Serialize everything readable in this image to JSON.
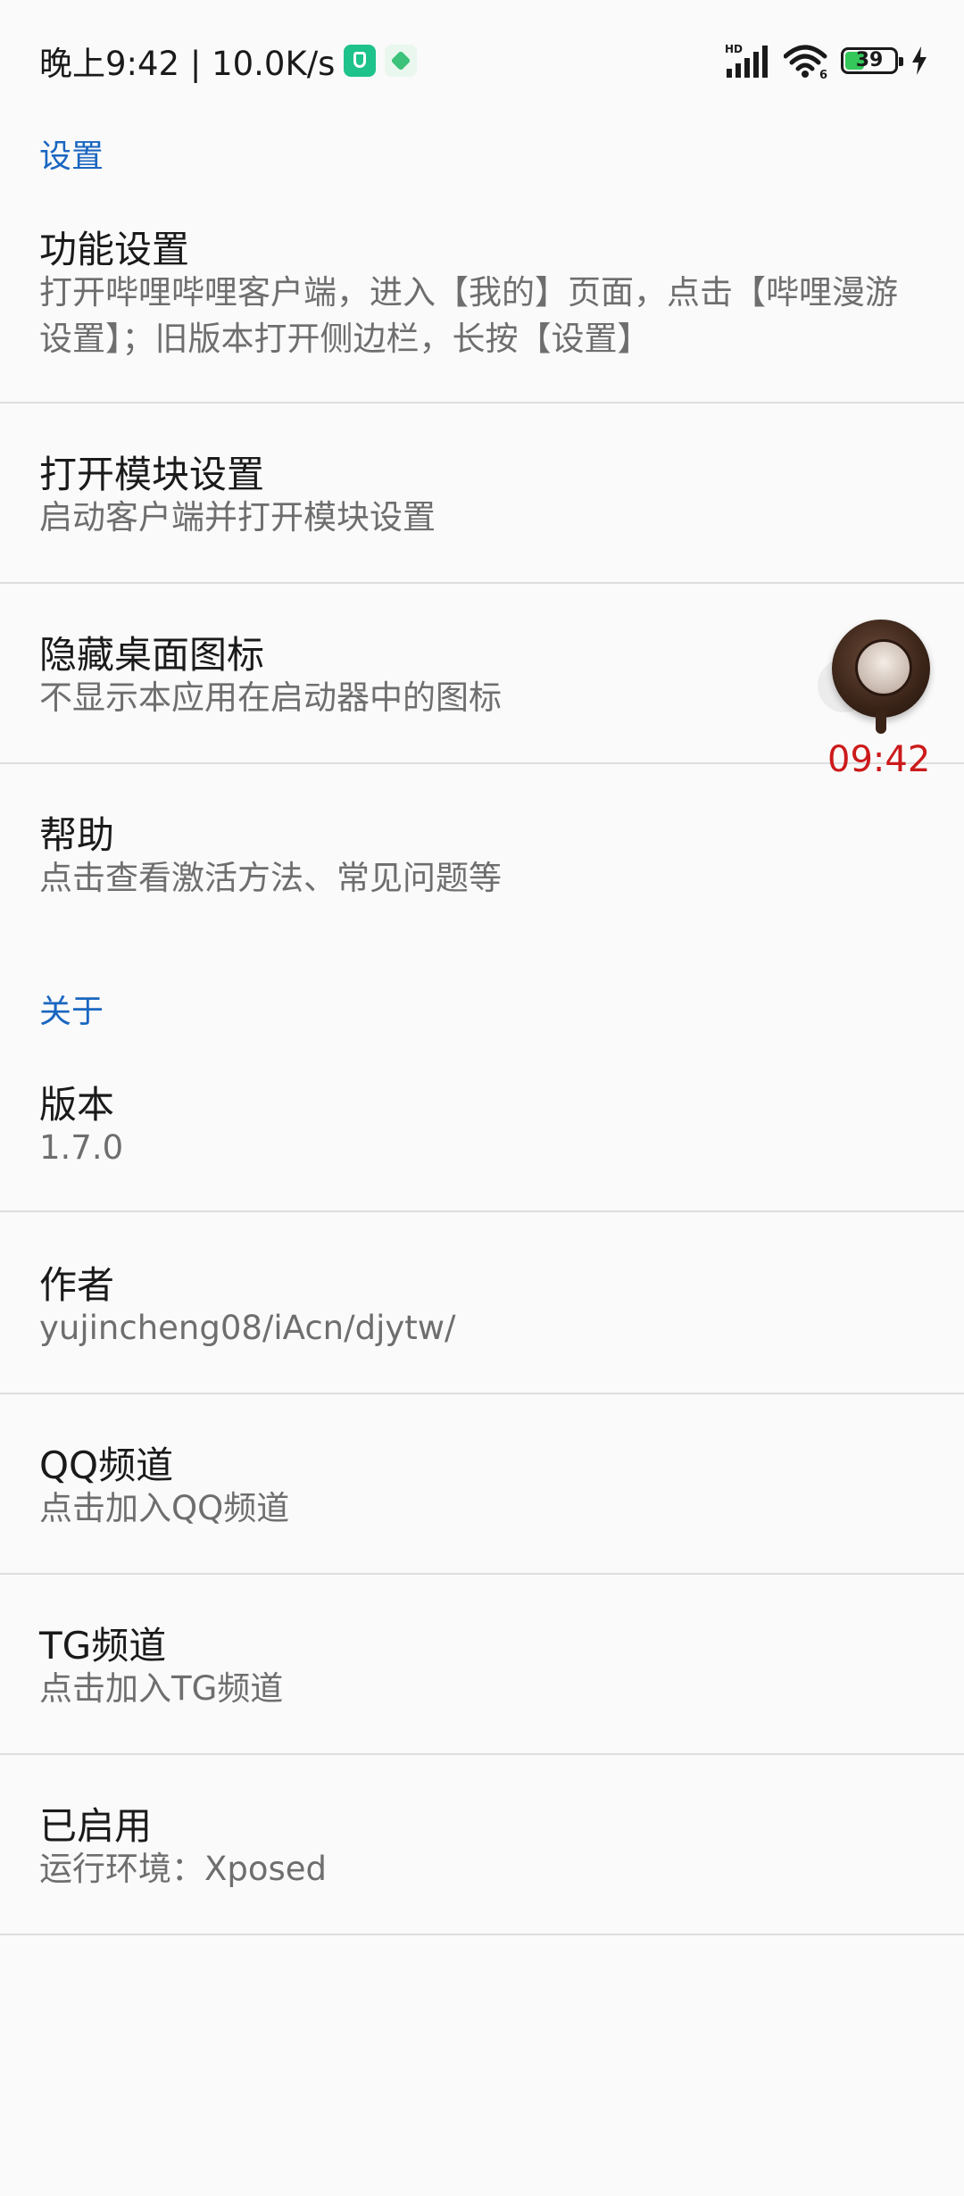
{
  "status_bar": {
    "time_speed": "晚上9:42 | 10.0K/s",
    "signal_label": "HD",
    "wifi_label": "6",
    "battery_level": "39",
    "battery_fraction": 0.39,
    "app_icons": [
      "shield-app-icon",
      "cube-app-icon"
    ]
  },
  "sections": {
    "settings_header": "设置",
    "about_header": "关于"
  },
  "settings": {
    "feature": {
      "title": "功能设置",
      "summary": "打开哔哩哔哩客户端，进入【我的】页面，点击【哔哩漫游设置】；旧版本打开侧边栏，长按【设置】"
    },
    "open_module": {
      "title": "打开模块设置",
      "summary": "启动客户端并打开模块设置"
    },
    "hide_icon": {
      "title": "隐藏桌面图标",
      "summary": "不显示本应用在启动器中的图标"
    },
    "help": {
      "title": "帮助",
      "summary": "点击查看激活方法、常见问题等"
    }
  },
  "about": {
    "version": {
      "title": "版本",
      "summary": "1.7.0"
    },
    "author": {
      "title": "作者",
      "summary": "yujincheng08/iAcn/djytw/"
    },
    "qq": {
      "title": "QQ频道",
      "summary": "点击加入QQ频道"
    },
    "tg": {
      "title": "TG频道",
      "summary": "点击加入TG频道"
    },
    "enabled": {
      "title": "已启用",
      "summary": "运行环境：Xposed"
    }
  },
  "floating_widget": {
    "time": "09:42"
  },
  "colors": {
    "accent": "#1a66c0",
    "background": "#fafafa",
    "divider": "#dedede",
    "float_time": "#cc1a1a",
    "battery": "#34c759"
  }
}
